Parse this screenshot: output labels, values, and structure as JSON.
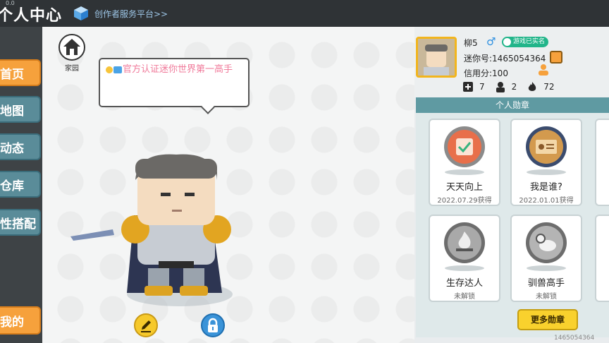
{
  "header": {
    "title": "个人中心",
    "version_fragment": "0.0",
    "creator_link": "创作者服务平台>>"
  },
  "sidebar": {
    "items": [
      {
        "label": "首页",
        "active": true
      },
      {
        "label": "地图",
        "active": false
      },
      {
        "label": "动态",
        "active": false
      },
      {
        "label": "仓库",
        "active": false
      },
      {
        "label": "性搭配",
        "active": false
      }
    ],
    "mine_label": "我的"
  },
  "scene": {
    "home_label": "家园",
    "bubble_text": "官方认证迷你世界第一高手"
  },
  "profile": {
    "name": "柳5",
    "gender_symbol": "♂",
    "verify_badge": "游戏已实名",
    "mini_id": "迷你号:1465054364",
    "credit": "信用分:100",
    "stats": [
      {
        "icon": "add-friend-icon",
        "value": "7"
      },
      {
        "icon": "fans-icon",
        "value": "2"
      },
      {
        "icon": "fire-icon",
        "value": "72"
      }
    ]
  },
  "medals": {
    "header": "个人勋章",
    "items": [
      {
        "name": "天天向上",
        "sub": "2022.07.29获得",
        "color": "#e86f4a",
        "icon": "clipboard-medal-icon"
      },
      {
        "name": "我是谁?",
        "sub": "2022.01.01获得",
        "color": "#d39a4e",
        "icon": "id-card-medal-icon"
      },
      {
        "name": "生存达人",
        "sub": "未解锁",
        "color": "#8e8e8e",
        "icon": "campfire-medal-icon"
      },
      {
        "name": "驯兽高手",
        "sub": "未解锁",
        "color": "#8e8e8e",
        "icon": "ram-medal-icon"
      }
    ],
    "more_button": "更多勋章"
  },
  "footer": {
    "id_text": "1465054364"
  },
  "colors": {
    "accent_orange": "#f6a13c",
    "sidebar_teal": "#5a8c99",
    "medal_header": "#5f9aa2",
    "bubble_text": "#f07a9a"
  }
}
